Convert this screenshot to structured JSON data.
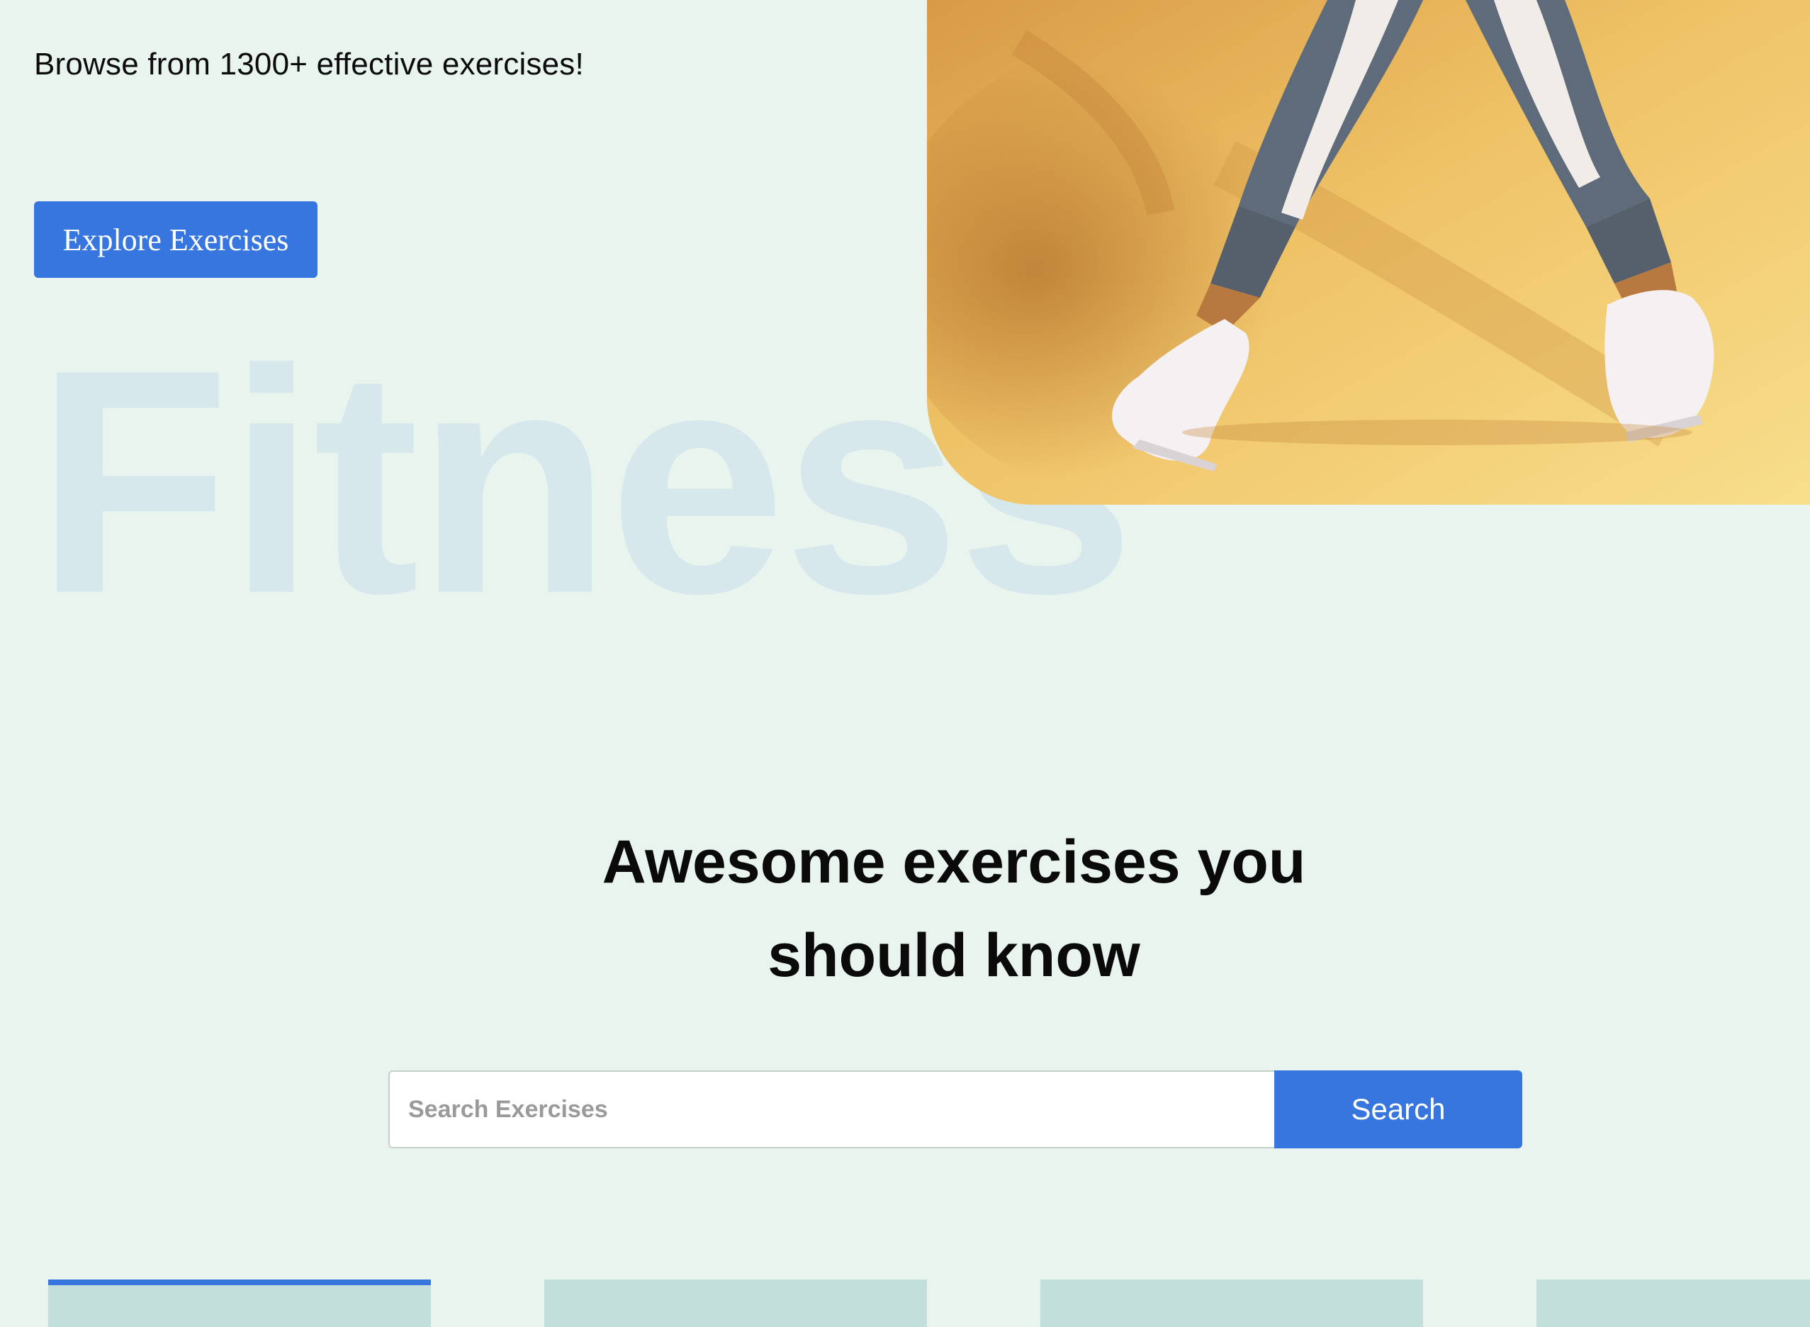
{
  "hero": {
    "subtitle": "Browse from 1300+ effective exercises!",
    "cta_label": "Explore Exercises",
    "background_word": "Fitness",
    "image_alt": "runner-legs-photo"
  },
  "search_section": {
    "title_line1": "Awesome exercises you",
    "title_line2": "should know",
    "placeholder": "Search Exercises",
    "button_label": "Search"
  },
  "categories": {
    "count_visible": 4
  },
  "colors": {
    "background": "#e9f4ee",
    "accent": "#3776de",
    "background_word": "#d7e8ec",
    "card": "#c2dfdb",
    "hero_image_yellow": "#f6d27a"
  }
}
